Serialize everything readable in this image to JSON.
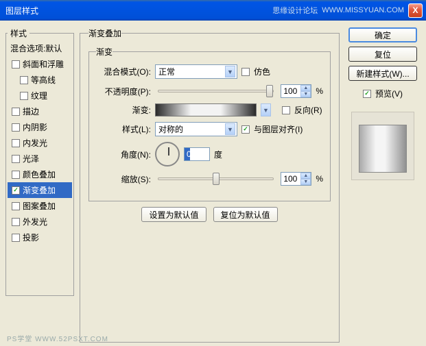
{
  "titlebar": {
    "title": "图层样式",
    "forum": "思缘设计论坛",
    "url": "WWW.MISSYUAN.COM"
  },
  "close_icon": "X",
  "styles_panel": {
    "header": "样式",
    "blend_options": "混合选项:默认",
    "items": [
      {
        "label": "斜面和浮雕",
        "checked": false,
        "selected": false,
        "indent": 0
      },
      {
        "label": "等高线",
        "checked": false,
        "selected": false,
        "indent": 1
      },
      {
        "label": "纹理",
        "checked": false,
        "selected": false,
        "indent": 1
      },
      {
        "label": "描边",
        "checked": false,
        "selected": false,
        "indent": 0
      },
      {
        "label": "内阴影",
        "checked": false,
        "selected": false,
        "indent": 0
      },
      {
        "label": "内发光",
        "checked": false,
        "selected": false,
        "indent": 0
      },
      {
        "label": "光泽",
        "checked": false,
        "selected": false,
        "indent": 0
      },
      {
        "label": "颜色叠加",
        "checked": false,
        "selected": false,
        "indent": 0
      },
      {
        "label": "渐变叠加",
        "checked": true,
        "selected": true,
        "indent": 0
      },
      {
        "label": "图案叠加",
        "checked": false,
        "selected": false,
        "indent": 0
      },
      {
        "label": "外发光",
        "checked": false,
        "selected": false,
        "indent": 0
      },
      {
        "label": "投影",
        "checked": false,
        "selected": false,
        "indent": 0
      }
    ]
  },
  "center": {
    "group_title": "渐变叠加",
    "inner_title": "渐变",
    "blend_mode_label": "混合模式(O):",
    "blend_mode_value": "正常",
    "dither_label": "仿色",
    "opacity_label": "不透明度(P):",
    "opacity_value": "100",
    "percent": "%",
    "gradient_label": "渐变:",
    "reverse_label": "反向(R)",
    "style_label": "样式(L):",
    "style_value": "对称的",
    "align_label": "与图层对齐(I)",
    "angle_label": "角度(N):",
    "angle_value": "0",
    "degree": "度",
    "scale_label": "缩放(S):",
    "scale_value": "100",
    "set_default": "设置为默认值",
    "reset_default": "复位为默认值"
  },
  "right": {
    "ok": "确定",
    "reset": "复位",
    "new_style": "新建样式(W)...",
    "preview_label": "预览(V)"
  },
  "watermark": "PS学堂  WWW.52PSXT.COM"
}
